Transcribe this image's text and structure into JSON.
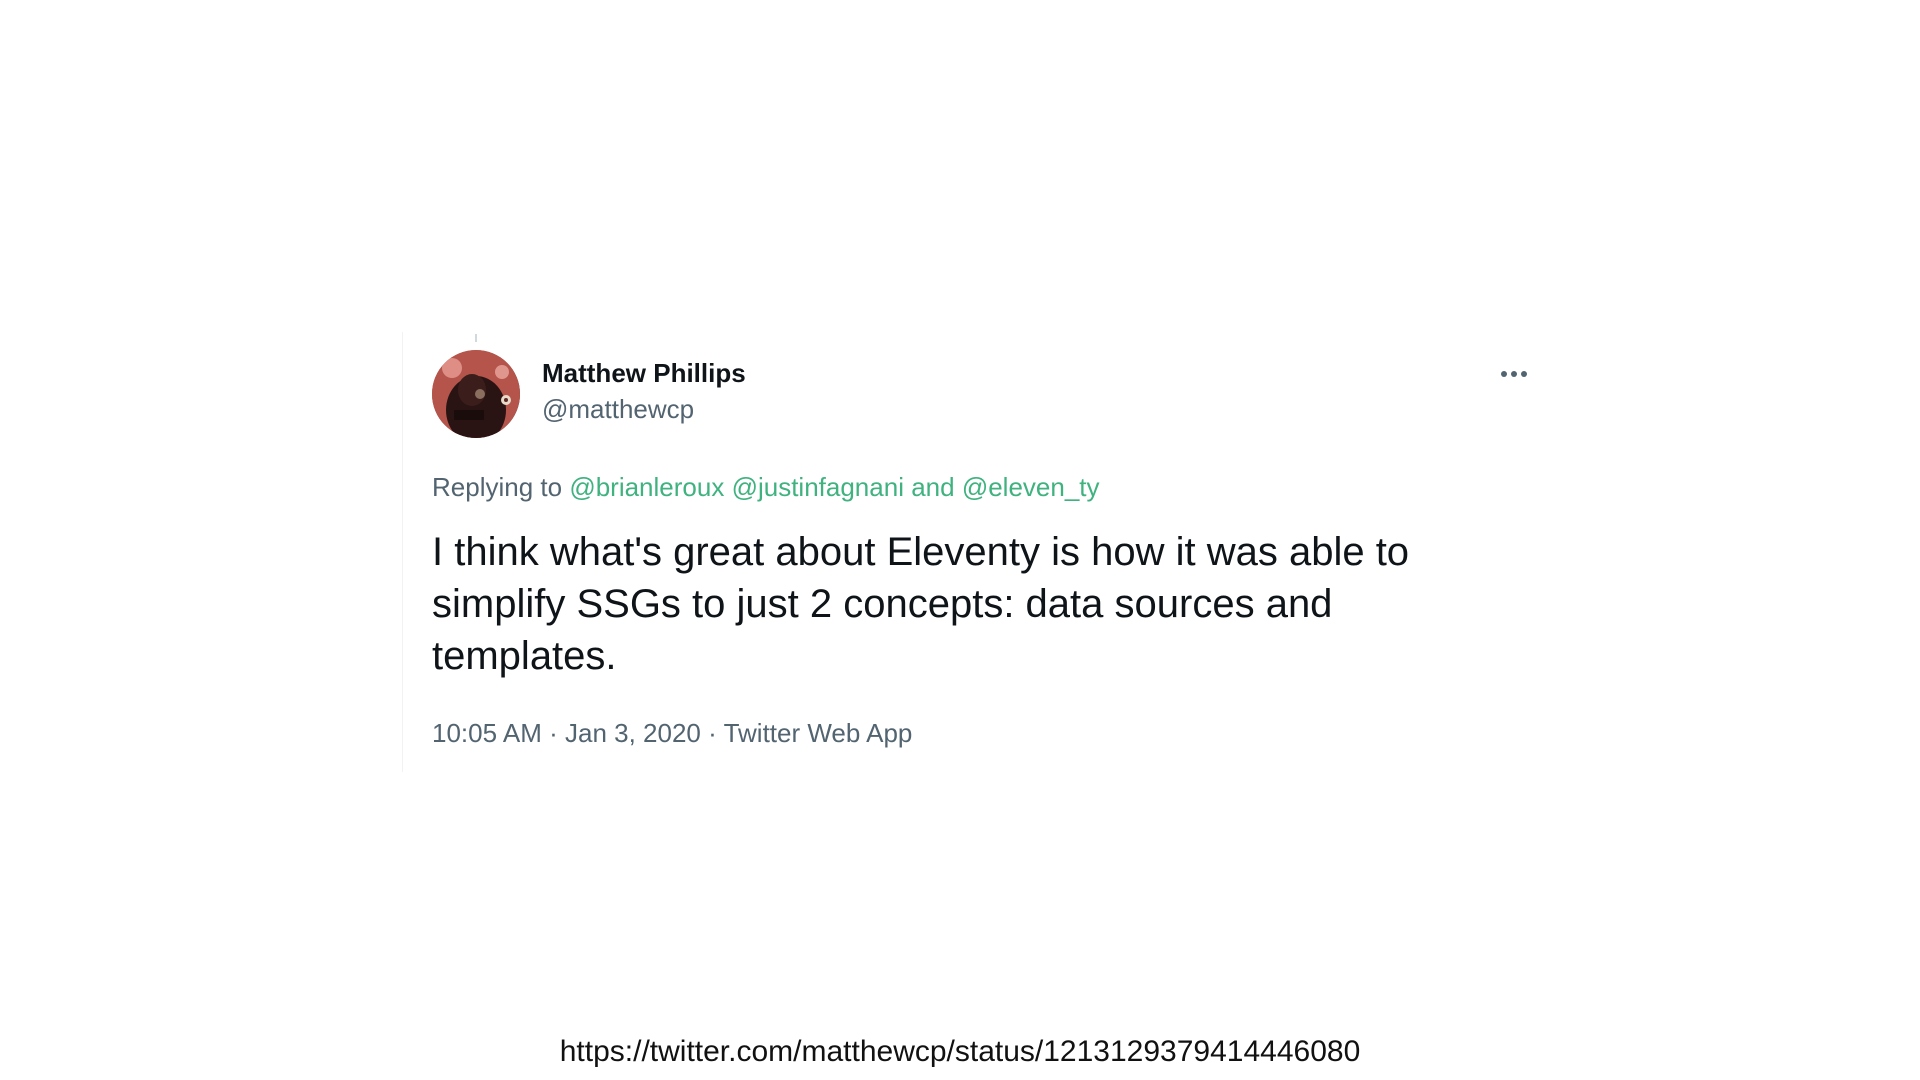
{
  "tweet": {
    "author": {
      "display_name": "Matthew Phillips",
      "handle": "@matthewcp"
    },
    "reply": {
      "prefix": "Replying to",
      "mentions": [
        "@brianleroux",
        "@justinfagnani",
        "@eleven_ty"
      ],
      "connector": "and"
    },
    "text": "I think what's great about Eleventy is how it was able to simplify SSGs to just 2 concepts: data sources and templates.",
    "meta": {
      "time": "10:05 AM",
      "date": "Jan 3, 2020",
      "source": "Twitter Web App",
      "separator": "·"
    },
    "more_icon": "more-horizontal-icon"
  },
  "source_url": "https://twitter.com/matthewcp/status/1213129379414446080",
  "colors": {
    "mention": "#3fb27f",
    "secondary_text": "#536471",
    "primary_text": "#0f1419"
  }
}
